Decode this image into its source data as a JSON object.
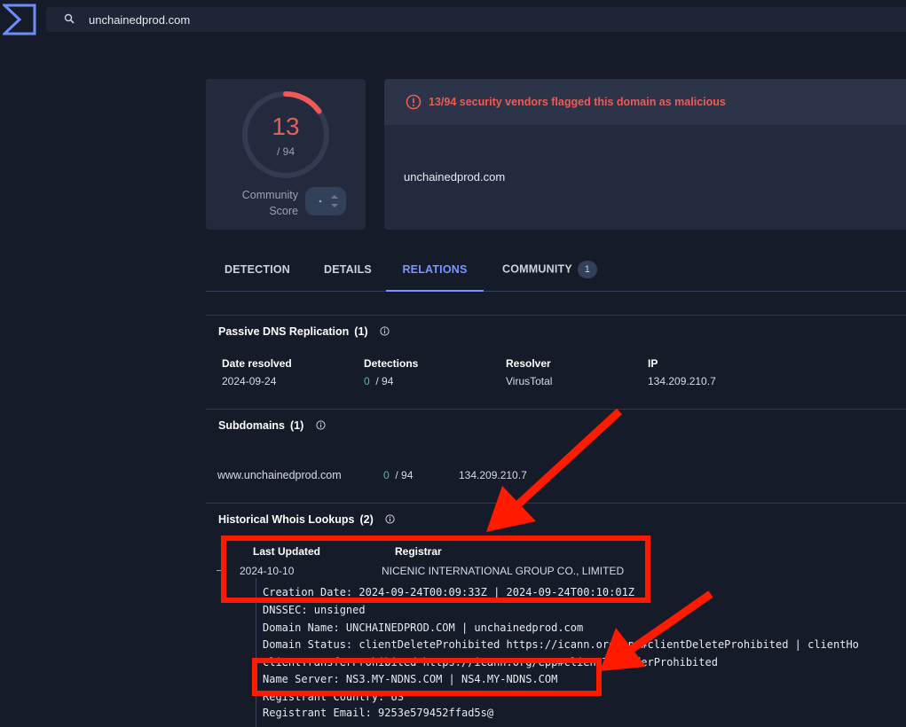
{
  "search": {
    "value": "unchainedprod.com"
  },
  "score": {
    "detections": "13",
    "total": "/ 94",
    "community_label_line1": "Community",
    "community_label_line2": "Score"
  },
  "alert": {
    "text": "13/94 security vendors flagged this domain as malicious",
    "domain": "unchainedprod.com"
  },
  "tabs": [
    {
      "label": "DETECTION"
    },
    {
      "label": "DETAILS"
    },
    {
      "label": "RELATIONS",
      "active": true
    },
    {
      "label": "COMMUNITY",
      "badge": "1"
    }
  ],
  "passive_dns": {
    "title": "Passive DNS Replication",
    "count": "(1)",
    "headers": [
      "Date resolved",
      "Detections",
      "Resolver",
      "IP"
    ],
    "row": {
      "date": "2024-09-24",
      "detections_good": "0",
      "detections_total": "/ 94",
      "resolver": "VirusTotal",
      "ip": "134.209.210.7"
    }
  },
  "subdomains": {
    "title": "Subdomains",
    "count": "(1)",
    "row": {
      "domain": "www.unchainedprod.com",
      "detections_good": "0",
      "detections_total": "/ 94",
      "ip": "134.209.210.7"
    }
  },
  "whois": {
    "title": "Historical Whois Lookups",
    "count": "(2)",
    "headers": [
      "Last Updated",
      "Registrar"
    ],
    "row": {
      "last_updated": "2024-10-10",
      "registrar": "NICENIC INTERNATIONAL GROUP CO., LIMITED"
    },
    "lines": [
      "Creation Date: 2024-09-24T00:09:33Z | 2024-09-24T00:10:01Z",
      "DNSSEC: unsigned",
      "Domain Name: UNCHAINEDPROD.COM | unchainedprod.com",
      "Domain Status: clientDeleteProhibited https://icann.org/epp#clientDeleteProhibited | clientHo",
      "clientTransferProhibited https://icann.org/epp#clientTransferProhibited",
      "Name Server: NS3.MY-NDNS.COM | NS4.MY-NDNS.COM",
      "Registrant Country: US",
      "Registrant Email: 9253e579452ffad5s@"
    ]
  },
  "colors": {
    "accent": "#7b96ff",
    "danger": "#f05a56",
    "good": "#3ec6a3",
    "annotation": "#ff1a00"
  }
}
